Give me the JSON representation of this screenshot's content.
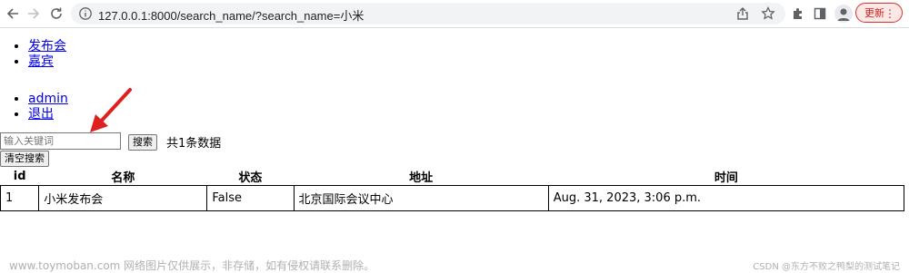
{
  "browser": {
    "url": "127.0.0.1:8000/search_name/?search_name=小米",
    "update_label": "更新",
    "more_label": "⋮"
  },
  "nav_primary": {
    "items": [
      {
        "label": "发布会"
      },
      {
        "label": "嘉宾"
      }
    ]
  },
  "nav_user": {
    "items": [
      {
        "label": "admin"
      },
      {
        "label": "退出"
      }
    ]
  },
  "search": {
    "placeholder": "输入关键词",
    "button_label": "搜索",
    "result_count_text": "共1条数据",
    "clear_label": "清空搜索"
  },
  "table": {
    "headers": [
      "id",
      "名称",
      "状态",
      "地址",
      "时间"
    ],
    "rows": [
      [
        "1",
        "小米发布会",
        "False",
        "北京国际会议中心",
        "Aug. 31, 2023, 3:06 p.m."
      ]
    ]
  },
  "watermark": {
    "left": "www.toymoban.com 网络图片仅供展示，非存储，如有侵权请联系删除。",
    "right": "CSDN @东方不败之鸭梨的测试笔记"
  },
  "colors": {
    "arrow": "#e02020",
    "link": "#0000ee",
    "update_accent": "#d93025"
  },
  "icons": [
    "back-icon",
    "forward-icon",
    "reload-icon",
    "info-icon",
    "share-icon",
    "star-icon",
    "extensions-icon",
    "sidepanel-icon",
    "profile-icon"
  ]
}
